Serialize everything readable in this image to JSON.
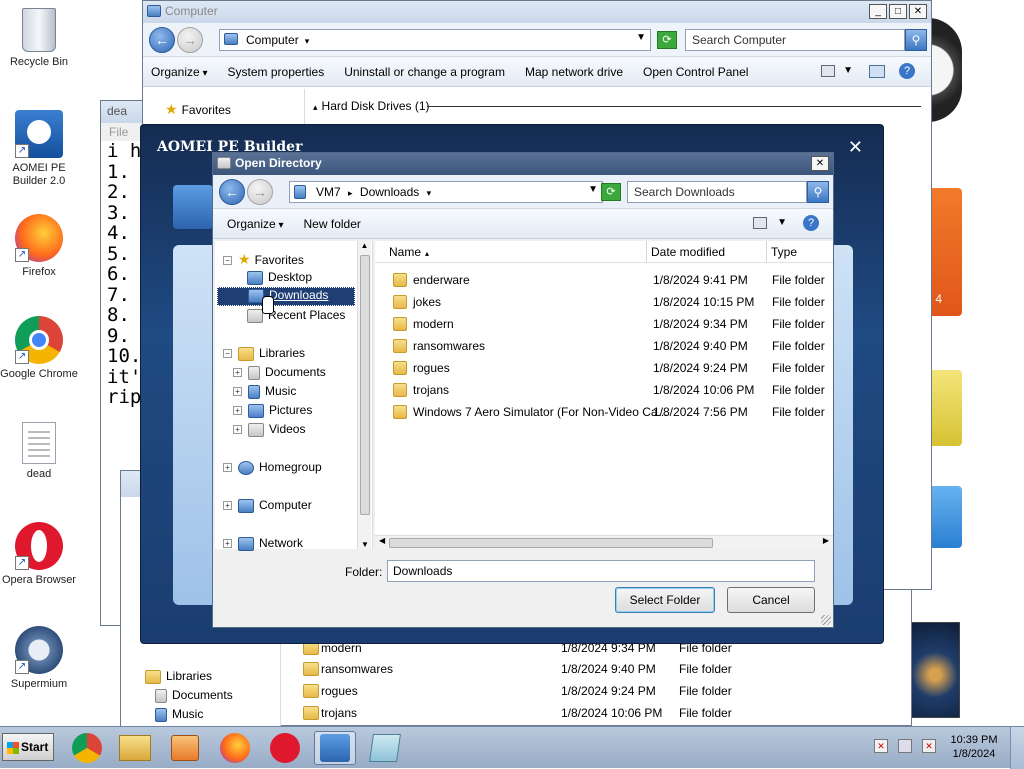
{
  "desktop": {
    "icons": [
      {
        "label": "Recycle Bin"
      },
      {
        "label": "AOMEI PE Builder 2.0"
      },
      {
        "label": "Firefox"
      },
      {
        "label": "Google Chrome"
      },
      {
        "label": "dead"
      },
      {
        "label": "Opera Browser"
      },
      {
        "label": "Supermium"
      }
    ],
    "background_color": "#ffffff"
  },
  "notepad": {
    "title": "dea",
    "menu_file": "File",
    "lines": [
      "i h",
      "1.",
      "2.",
      "3.",
      "4.",
      "5.",
      "6.",
      "7.",
      "8.",
      "9.",
      "10.",
      "it'",
      "rip"
    ]
  },
  "computer_window": {
    "title": "Computer",
    "address": "Computer",
    "search_placeholder": "Search Computer",
    "commands": [
      "Organize",
      "System properties",
      "Uninstall or change a program",
      "Map network drive",
      "Open Control Panel"
    ],
    "favorites_label": "Favorites",
    "group_header": "Hard Disk Drives (1)"
  },
  "aomei": {
    "title": "AOMEI PE Builder",
    "close": "✕"
  },
  "open_directory": {
    "title": "Open Directory",
    "breadcrumb": [
      "VM7",
      "Downloads"
    ],
    "search_placeholder": "Search Downloads",
    "toolbar": {
      "organize": "Organize",
      "new_folder": "New folder"
    },
    "nav": {
      "favorites": "Favorites",
      "desktop": "Desktop",
      "downloads": "Downloads",
      "recent_places": "Recent Places",
      "libraries": "Libraries",
      "documents": "Documents",
      "music": "Music",
      "pictures": "Pictures",
      "videos": "Videos",
      "homegroup": "Homegroup",
      "computer": "Computer",
      "network": "Network"
    },
    "columns": {
      "name": "Name",
      "date": "Date modified",
      "type": "Type"
    },
    "files": [
      {
        "name": "enderware",
        "date": "1/8/2024 9:41 PM",
        "type": "File folder"
      },
      {
        "name": "jokes",
        "date": "1/8/2024 10:15 PM",
        "type": "File folder"
      },
      {
        "name": "modern",
        "date": "1/8/2024 9:34 PM",
        "type": "File folder"
      },
      {
        "name": "ransomwares",
        "date": "1/8/2024 9:40 PM",
        "type": "File folder"
      },
      {
        "name": "rogues",
        "date": "1/8/2024 9:24 PM",
        "type": "File folder"
      },
      {
        "name": "trojans",
        "date": "1/8/2024 10:06 PM",
        "type": "File folder"
      },
      {
        "name": "Windows 7 Aero Simulator (For Non-Video Ca...",
        "date": "1/8/2024 7:56 PM",
        "type": "File folder"
      }
    ],
    "folder_label": "Folder:",
    "folder_value": "Downloads",
    "select_button": "Select Folder",
    "cancel_button": "Cancel"
  },
  "background_explorer": {
    "nav": {
      "libraries": "Libraries",
      "documents": "Documents",
      "music": "Music"
    },
    "files": [
      {
        "name": "modern",
        "date": "1/8/2024 9:34 PM",
        "type": "File folder"
      },
      {
        "name": "ransomwares",
        "date": "1/8/2024 9:40 PM",
        "type": "File folder"
      },
      {
        "name": "rogues",
        "date": "1/8/2024 9:24 PM",
        "type": "File folder"
      },
      {
        "name": "trojans",
        "date": "1/8/2024 10:06 PM",
        "type": "File folder"
      }
    ]
  },
  "taskbar": {
    "start_label": "Start",
    "time": "10:39 PM",
    "date": "1/8/2024"
  }
}
